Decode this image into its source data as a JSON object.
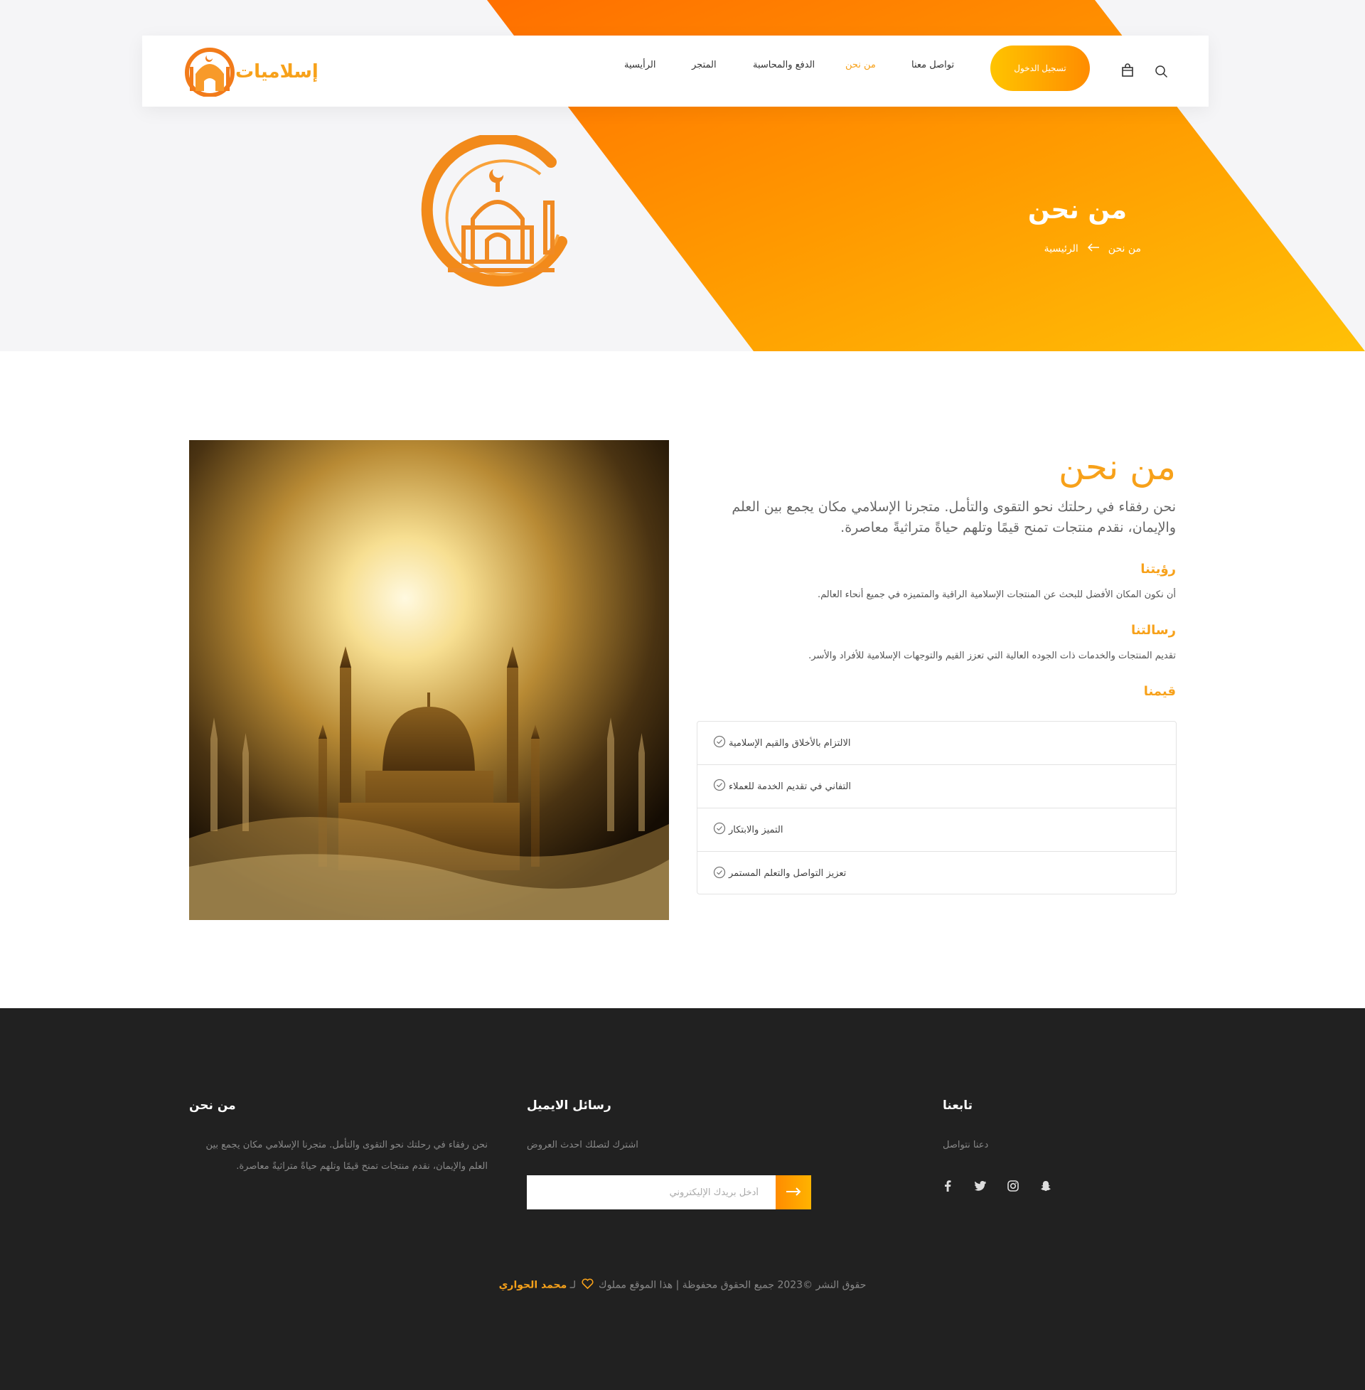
{
  "brand": {
    "name": "إسلاميات",
    "accent": "#f7a11a",
    "gradient_from": "#ff7a00",
    "gradient_to": "#ffc107"
  },
  "nav": {
    "items": [
      {
        "label": "الرأيسية",
        "active": false
      },
      {
        "label": "المتجر",
        "active": false
      },
      {
        "label": "الدفع والمحاسبة",
        "active": false
      },
      {
        "label": "من نحن",
        "active": true
      },
      {
        "label": "تواصل معنا",
        "active": false
      }
    ],
    "login_label": "تسجيل الدخول",
    "cart_icon": "bag-icon",
    "search_icon": "search-icon"
  },
  "hero": {
    "title": "من نحن",
    "breadcrumb": {
      "current": "من نحن",
      "home": "الرئيسية",
      "arrow_icon": "arrow-left-icon"
    }
  },
  "about": {
    "heading": "من نحن",
    "description": "نحن رفقاء في رحلتك نحو التقوى والتأمل. متجرنا الإسلامي مكان يجمع بين العلم والإيمان، نقدم منتجات تمنح قيمًا وتلهم حياةً متراثيةً معاصرة.",
    "vision": {
      "title": "رؤيتنا",
      "text": "أن نكون المكان الأفضل للبحث عن المنتجات الإسلامية الراقية والمتميزه في جميع أنحاء العالم."
    },
    "mission": {
      "title": "رسالتنا",
      "text": "تقديم المنتجات والخدمات ذات الجوده العالية التي تعزز القيم والتوجهات الإسلامية للأفراد والأسر."
    },
    "values": {
      "title": "قيمنا",
      "items": [
        "الالتزام بالأخلاق والقيم الإسلامية",
        "التفاني في تقديم الخدمة للعملاء",
        "التميز والابتكار",
        "تعزيز التواصل والتعلم المستمر"
      ],
      "check_icon": "check-circle-icon"
    }
  },
  "footer": {
    "about": {
      "title": "من نحن",
      "text": "نحن رفقاء في رحلتك نحو التقوى والتأمل. متجرنا الإسلامي مكان يجمع بين العلم والإيمان، نقدم منتجات تمنح قيمًا وتلهم حياةً متراثيةً معاصرة."
    },
    "newsletter": {
      "title": "رسائل الايميل",
      "text": "اشترك لتصلك احدث العروض",
      "placeholder": "أدخل بريدك الإليكتروني"
    },
    "follow": {
      "title": "تابعنا",
      "text": "دعنا نتواصل",
      "icons": [
        "facebook-icon",
        "twitter-icon",
        "instagram-icon",
        "snapchat-icon"
      ]
    },
    "copyright": {
      "prefix": "حقوق النشر ©2023 جميع الحقوق محفوظة | هذا الموقع مملوك",
      "connector": "لـ",
      "author": "محمد الحواري"
    }
  }
}
